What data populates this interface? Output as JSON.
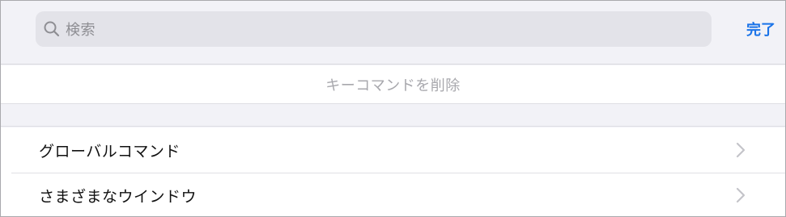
{
  "search": {
    "placeholder": "検索",
    "icon": "search-icon"
  },
  "toolbar": {
    "done_label": "完了"
  },
  "actions": {
    "delete_label": "キーコマンドを削除"
  },
  "list": {
    "items": [
      {
        "label": "グローバルコマンド",
        "icon": "chevron-right-icon"
      },
      {
        "label": "さまざまなウインドウ",
        "icon": "chevron-right-icon"
      }
    ]
  },
  "colors": {
    "background": "#f2f2f7",
    "accent": "#1a73e8",
    "search_field": "#e3e3e9",
    "disabled_text": "#a8a8ad"
  }
}
